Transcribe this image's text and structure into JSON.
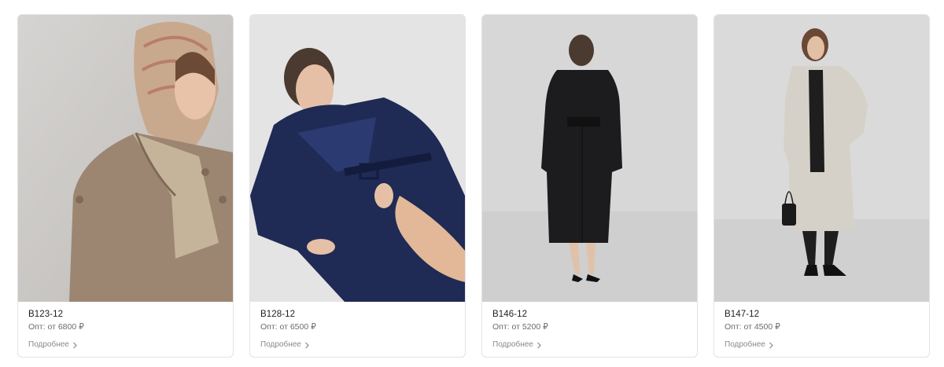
{
  "products": [
    {
      "sku": "B123-12",
      "price": "Опт: от 6800 ₽",
      "more": "Подробнее",
      "image_alt": "trench-coat-beige"
    },
    {
      "sku": "B128-12",
      "price": "Опт: от 6500 ₽",
      "more": "Подробнее",
      "image_alt": "leather-trench-navy"
    },
    {
      "sku": "B146-12",
      "price": "Опт: от 5200 ₽",
      "more": "Подробнее",
      "image_alt": "trench-coat-black"
    },
    {
      "sku": "B147-12",
      "price": "Опт: от 4500 ₽",
      "more": "Подробнее",
      "image_alt": "coat-light-grey"
    }
  ],
  "colors": {
    "card_border": "#e3e3e3",
    "sku_text": "#1e1e1e",
    "price_text": "#6b6b6b",
    "link_text": "#8a8a8a"
  }
}
